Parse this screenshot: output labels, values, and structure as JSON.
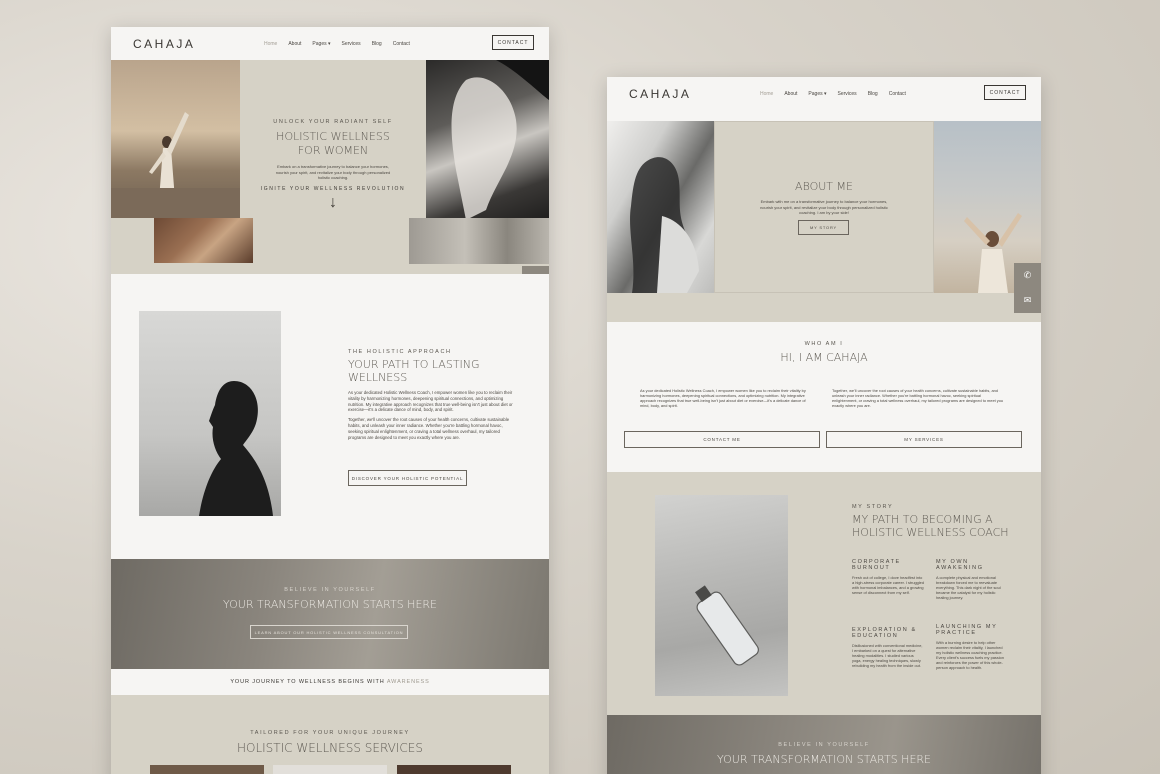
{
  "left": {
    "logo": "CAHAJA",
    "nav": [
      "Home",
      "About",
      "Pages ▾",
      "Services",
      "Blog",
      "Contact"
    ],
    "contact_button": "CONTACT",
    "hero": {
      "eyebrow": "UNLOCK YOUR RADIANT SELF",
      "title_line1": "HOLISTIC WELLNESS",
      "title_line2": "FOR WOMEN",
      "body": "Embark on a transformative journey to balance your hormones, nourish your spirit, and revitalize your body through personalized holistic coaching.",
      "cta": "IGNITE YOUR WELLNESS REVOLUTION",
      "arrow": "↓"
    },
    "approach": {
      "eyebrow": "THE HOLISTIC APPROACH",
      "title_line1": "YOUR PATH TO LASTING",
      "title_line2": "WELLNESS",
      "para1": "As your dedicated Holistic Wellness Coach, I empower women like you to reclaim their vitality by harmonizing hormones, deepening spiritual connections, and optimizing nutrition. My integrative approach recognizes that true well-being isn't just about diet or exercise—it's a delicate dance of mind, body, and spirit.",
      "para2": "Together, we'll uncover the root causes of your health concerns, cultivate sustainable habits, and unleash your inner radiance. Whether you're battling hormonal havoc, seeking spiritual enlightenment, or craving a total wellness overhaul, my tailored programs are designed to meet you exactly where you are.",
      "button": "DISCOVER YOUR HOLISTIC POTENTIAL"
    },
    "banner": {
      "eyebrow": "BELIEVE IN YOURSELF",
      "title": "YOUR TRANSFORMATION STARTS HERE",
      "button": "LEARN ABOUT OUR HOLISTIC WELLNESS CONSULTATION"
    },
    "strip": {
      "text": "YOUR JOURNEY TO WELLNESS BEGINS WITH",
      "accent": "AWARENESS"
    },
    "services": {
      "eyebrow": "TAILORED FOR YOUR UNIQUE JOURNEY",
      "title": "HOLISTIC WELLNESS SERVICES"
    },
    "icons": [
      "whatsapp-icon",
      "mail-icon"
    ]
  },
  "right": {
    "logo": "CAHAJA",
    "nav": [
      "Home",
      "About",
      "Pages ▾",
      "Services",
      "Blog",
      "Contact"
    ],
    "contact_button": "CONTACT",
    "about": {
      "title": "ABOUT ME",
      "body": "Embark with me on a transformative journey to balance your hormones, nourish your spirit, and revitalize your body through personalized holistic coaching. I am by your side!",
      "button": "MY STORY"
    },
    "who": {
      "eyebrow": "WHO AM I",
      "title": "HI, I AM CAHAJA",
      "col1": "As your dedicated Holistic Wellness Coach, I empower women like you to reclaim their vitality by harmonizing hormones, deepening spiritual connections, and optimizing nutrition. My integrative approach recognizes that true well-being isn't just about diet or exercise—it's a delicate dance of mind, body, and spirit.",
      "col2": "Together, we'll uncover the root causes of your health concerns, cultivate sustainable habits, and unleash your inner radiance. Whether you're battling hormonal havoc, seeking spiritual enlightenment, or craving a total wellness overhaul, my tailored programs are designed to meet you exactly where you are.",
      "btn_contact": "CONTACT ME",
      "btn_services": "MY SERVICES"
    },
    "story": {
      "eyebrow": "MY STORY",
      "title_line1": "MY PATH TO BECOMING A",
      "title_line2": "HOLISTIC WELLNESS COACH",
      "items": [
        {
          "title": "CORPORATE BURNOUT",
          "body": "Fresh out of college, I dove headfirst into a high-stress corporate career. I struggled with hormonal imbalances, and a growing sense of disconnect from my self."
        },
        {
          "title": "MY OWN AWAKENING",
          "body": "A complete physical and emotional breakdown forced me to reevaluate everything. This dark night of the soul became the catalyst for my holistic healing journey."
        },
        {
          "title": "EXPLORATION & EDUCATION",
          "body": "Disillusioned with conventional medicine, I embarked on a quest for alternative healing modalities. I studied various yoga, energy healing techniques, slowly rebuilding my health from the inside out."
        },
        {
          "title": "LAUNCHING MY PRACTICE",
          "body": "With a burning desire to help other women reclaim their vitality, I launched my holistic wellness coaching practice. Every client's success fuels my passion and reinforces the power of this whole-person approach to health."
        }
      ]
    },
    "banner": {
      "eyebrow": "BELIEVE IN YOURSELF",
      "title": "YOUR TRANSFORMATION STARTS HERE"
    },
    "icons": [
      "whatsapp-icon",
      "mail-icon"
    ]
  }
}
